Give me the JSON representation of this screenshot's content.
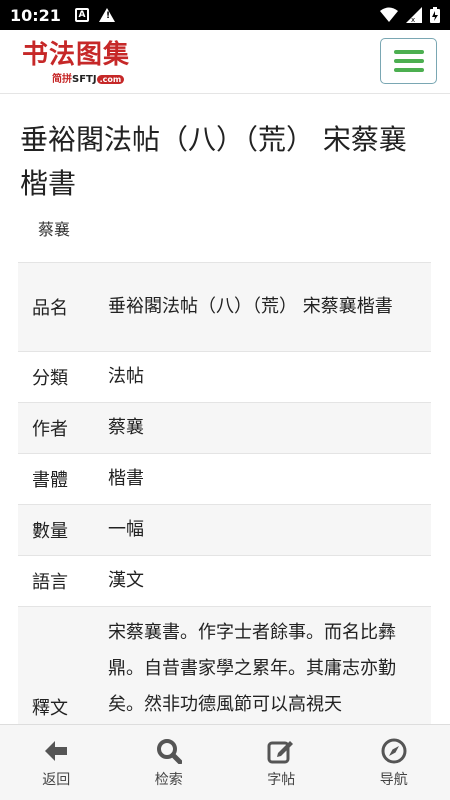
{
  "status_bar": {
    "time": "10:21",
    "icon_a_letter": "A",
    "warning_mark": "!"
  },
  "header": {
    "logo_main": "书法图集",
    "logo_sub_cn": "简拼",
    "logo_sub_en": "SFTJ",
    "logo_sub_tld": ".com"
  },
  "page": {
    "title": "垂裕閣法帖（八）（荒） 宋蔡襄楷書",
    "author_tag": "蔡襄"
  },
  "info": {
    "rows": [
      {
        "key": "品名",
        "value": "垂裕閣法帖（八）（荒） 宋蔡襄楷書"
      },
      {
        "key": "分類",
        "value": "法帖"
      },
      {
        "key": "作者",
        "value": "蔡襄"
      },
      {
        "key": "書體",
        "value": "楷書"
      },
      {
        "key": "數量",
        "value": "一幅"
      },
      {
        "key": "語言",
        "value": "漢文"
      },
      {
        "key": "釋文",
        "value": "宋蔡襄書。作字士者餘事。而名比彝鼎。自昔書家學之累年。其庸志亦勤矣。然非功德風節可以高視天"
      }
    ]
  },
  "bottom_nav": {
    "items": [
      {
        "label": "返回",
        "icon": "back-arrow-icon"
      },
      {
        "label": "检索",
        "icon": "search-icon"
      },
      {
        "label": "字帖",
        "icon": "edit-icon"
      },
      {
        "label": "导航",
        "icon": "compass-icon"
      }
    ]
  },
  "colors": {
    "logo_red": "#c62828",
    "menu_green": "#4caf50",
    "menu_border": "#7aa7b3",
    "icon_gray": "#555555"
  }
}
